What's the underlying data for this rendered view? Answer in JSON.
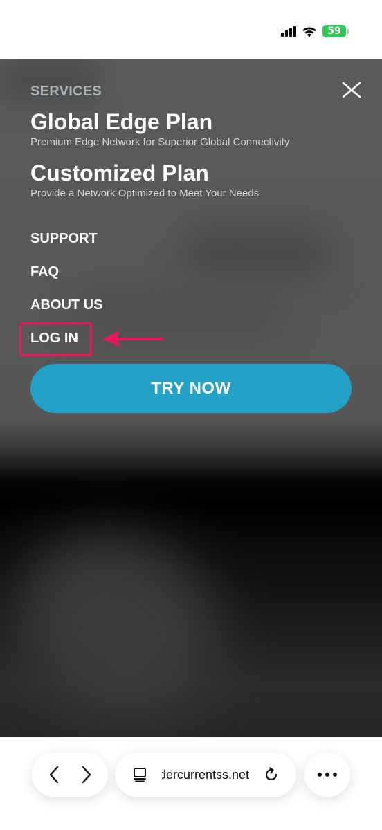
{
  "status_bar": {
    "battery_level": "59",
    "battery_color": "#34c759",
    "icons": [
      "signal-icon",
      "wifi-icon",
      "battery-charging-icon"
    ]
  },
  "menu": {
    "services_label": "SERVICES",
    "plans": [
      {
        "title": "Global Edge Plan",
        "description": "Premium Edge Network for Superior Global Connectivity"
      },
      {
        "title": "Customized Plan",
        "description": "Provide a Network Optimized to Meet Your Needs"
      }
    ],
    "links": [
      {
        "label": "SUPPORT"
      },
      {
        "label": "FAQ"
      },
      {
        "label": "ABOUT US"
      },
      {
        "label": "LOG IN"
      }
    ],
    "cta_label": "TRY NOW",
    "cta_color": "#24a1c6",
    "highlight_color": "#e8175d",
    "close_icon": "close-icon"
  },
  "browser_bar": {
    "url": "dercurrentss.net",
    "icons": [
      "back-icon",
      "forward-icon",
      "tabs-icon",
      "reload-icon",
      "more-icon"
    ]
  }
}
